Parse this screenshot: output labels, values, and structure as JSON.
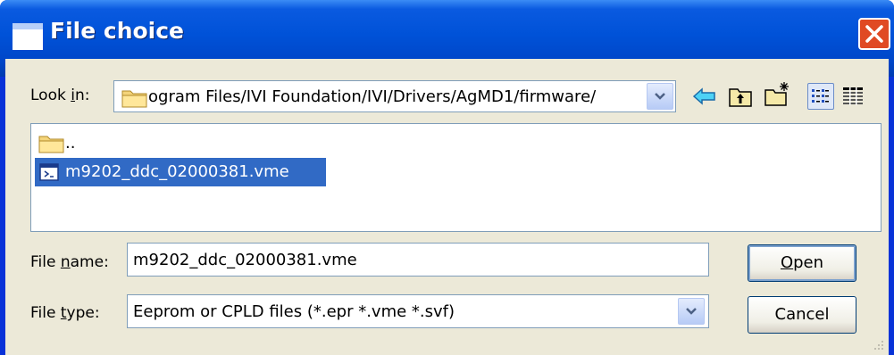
{
  "window": {
    "title": "File choice"
  },
  "look_in": {
    "label_pre": "Look ",
    "label_key": "i",
    "label_post": "n:",
    "path": "ogram Files/IVI Foundation/IVI/Drivers/AgMD1/firmware/"
  },
  "toolbar": {
    "back_icon": "back-arrow-icon",
    "up_icon": "up-folder-icon",
    "new_folder_icon": "new-folder-icon",
    "list_view_icon": "list-view-icon",
    "details_view_icon": "details-view-icon"
  },
  "file_list": {
    "items": [
      {
        "name": "..",
        "icon": "folder-icon",
        "selected": false
      },
      {
        "name": "m9202_ddc_02000381.vme",
        "icon": "file-icon",
        "selected": true
      }
    ]
  },
  "file_name": {
    "label_pre": "File ",
    "label_key": "n",
    "label_post": "ame:",
    "value": "m9202_ddc_02000381.vme"
  },
  "file_type": {
    "label_pre": "File ",
    "label_key": "t",
    "label_post": "ype:",
    "value": "Eeprom or CPLD files (*.epr *.vme *.svf)"
  },
  "buttons": {
    "open_key": "O",
    "open_rest": "pen",
    "cancel": "Cancel"
  },
  "colors": {
    "titlebar": "#0052d8",
    "selection": "#316ac5",
    "dialog_bg": "#ece9d8",
    "close": "#e04a24"
  }
}
